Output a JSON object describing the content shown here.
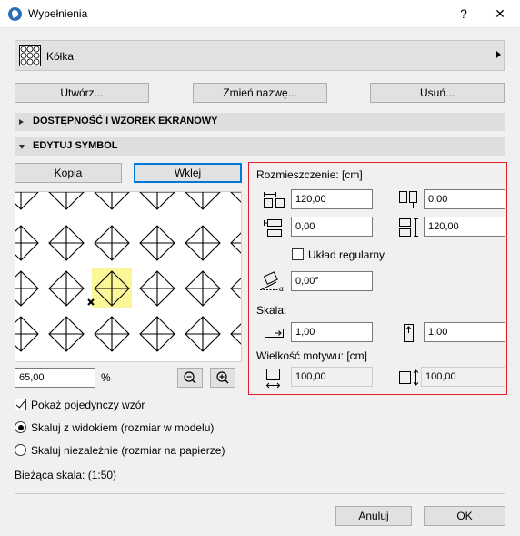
{
  "window": {
    "title": "Wypełnienia",
    "help_label": "?",
    "close_label": "✕"
  },
  "selector": {
    "name": "Kółka"
  },
  "top_buttons": {
    "create": "Utwórz...",
    "rename": "Zmień nazwę...",
    "delete": "Usuń..."
  },
  "sections": {
    "availability": "DOSTĘPNOŚĆ I WZOREK EKRANOWY",
    "edit_symbol": "EDYTUJ SYMBOL"
  },
  "symbol_buttons": {
    "copy": "Kopia",
    "paste": "Wklej"
  },
  "preview": {
    "zoom_value": "65,00",
    "zoom_unit": "%"
  },
  "placement": {
    "header": "Rozmieszczenie: [cm]",
    "h_spacing": "120,00",
    "v_offset": "0,00",
    "h_offset": "0,00",
    "v_spacing": "120,00",
    "regular_layout_label": "Układ regularny",
    "regular_layout_checked": false,
    "angle": "0,00°"
  },
  "scale": {
    "header": "Skala:",
    "x": "1,00",
    "y": "1,00"
  },
  "motif_size": {
    "header": "Wielkość motywu: [cm]",
    "width": "100,00",
    "height": "100,00"
  },
  "options": {
    "show_single_pattern": "Pokaż pojedynczy wzór",
    "show_single_checked": true,
    "scale_with_view": "Skaluj z widokiem (rozmiar w modelu)",
    "scale_independent": "Skaluj niezależnie (rozmiar na papierze)",
    "selected_scale_mode": "scale_with_view",
    "current_scale": "Bieżąca skala: (1:50)"
  },
  "footer": {
    "cancel": "Anuluj",
    "ok": "OK"
  },
  "colors": {
    "accent_focus": "#0078d7",
    "highlight_cell": "#fcf89a",
    "red_frame": "#e0202a"
  }
}
